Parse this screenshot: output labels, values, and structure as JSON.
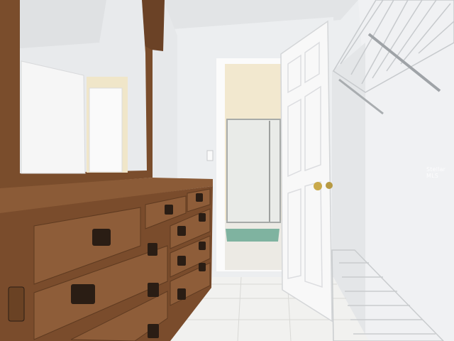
{
  "image": {
    "description_tags": [
      "room-interior",
      "walk-in-closet",
      "dresser",
      "mirror",
      "open-door",
      "bathroom",
      "wire-shelving",
      "tile-floor"
    ],
    "watermark": "Stellar MLS"
  },
  "colors": {
    "wall": "#eef0f2",
    "ceiling": "#e4e6e8",
    "wood": "#8a5a36",
    "wood_dark": "#5e3a20",
    "tile": "#f4f4f2",
    "door": "#f7f7f7",
    "rug": "#7fb3a0",
    "bath_glow": "#f3e7c9"
  }
}
